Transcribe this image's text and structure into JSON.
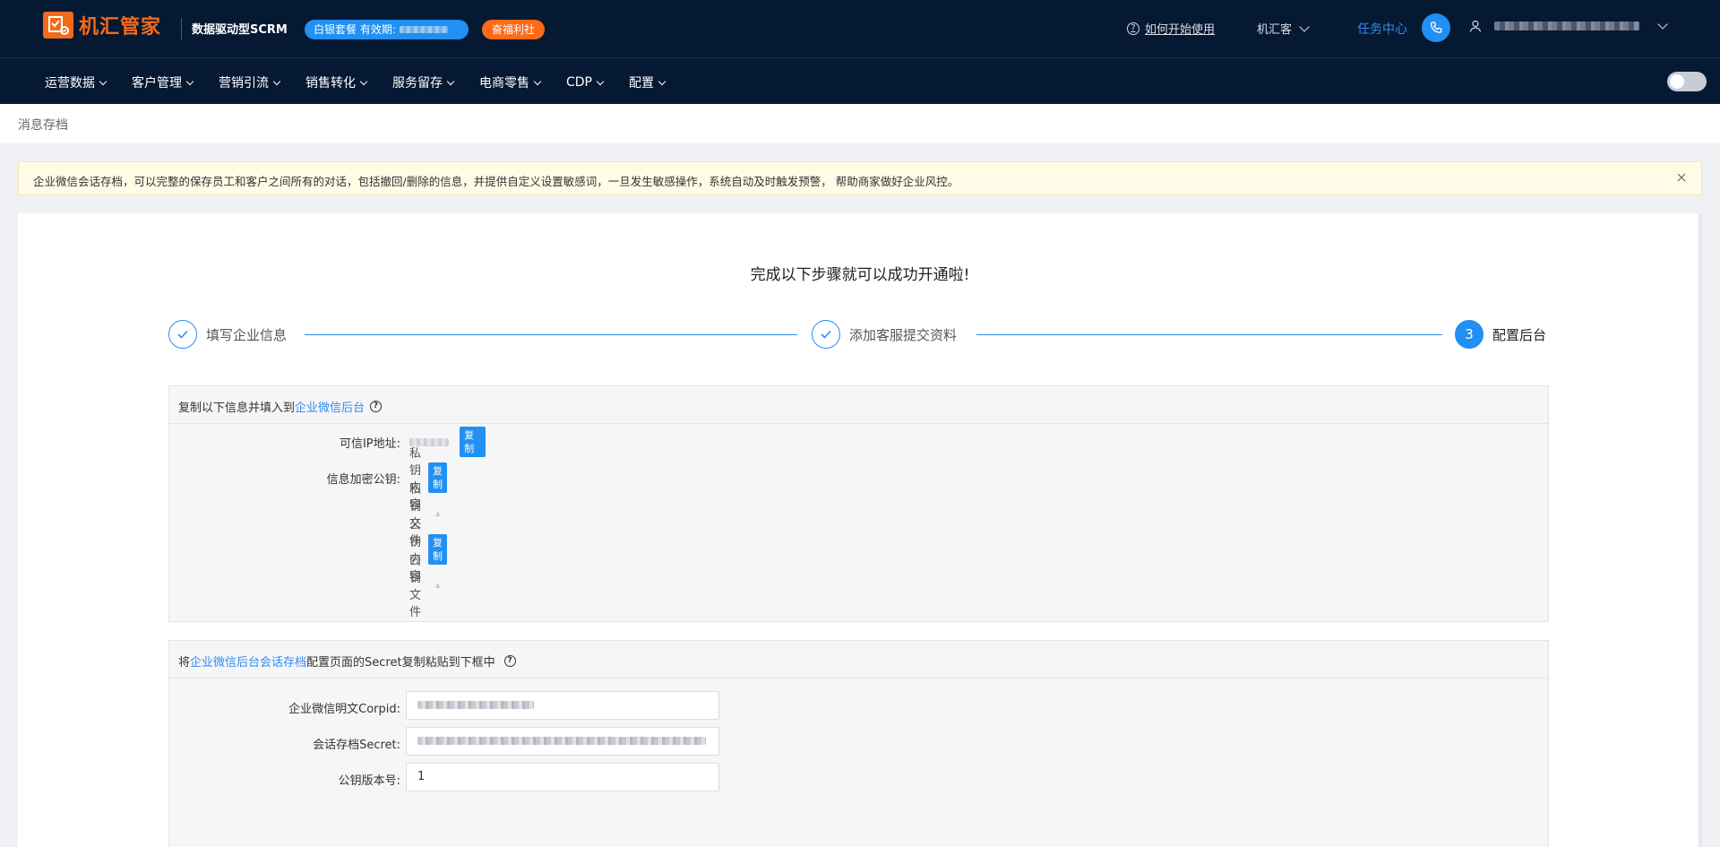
{
  "header": {
    "logo_text": "机汇管家",
    "slogan": "数据驱动型SCRM",
    "package_badge": "白银套餐 有效期:",
    "welfare_badge": "奋福利社",
    "help_link": "如何开始使用",
    "brand_select": "机汇客",
    "task_center": "任务中心"
  },
  "nav": {
    "items": [
      {
        "label": "运营数据"
      },
      {
        "label": "客户管理"
      },
      {
        "label": "营销引流"
      },
      {
        "label": "销售转化"
      },
      {
        "label": "服务留存"
      },
      {
        "label": "电商零售"
      },
      {
        "label": "CDP"
      },
      {
        "label": "配置"
      }
    ]
  },
  "breadcrumb": "消息存档",
  "alert": {
    "text": "企业微信会话存档，可以完整的保存员工和客户之间所有的对话，包括撤回/删除的信息，并提供自定义设置敏感词，一旦发生敏感操作，系统自动及时触发预警， 帮助商家做好企业风控。"
  },
  "main": {
    "title": "完成以下步骤就可以成功开通啦!",
    "steps": [
      {
        "label": "填写企业信息",
        "status": "done"
      },
      {
        "label": "添加客服提交资料",
        "status": "done"
      },
      {
        "number": "3",
        "label": "配置后台",
        "status": "active"
      }
    ],
    "section1": {
      "prefix": "复制以下信息并填入到",
      "link": "企业微信后台",
      "rows": {
        "trusted_ip_label": "可信IP地址:",
        "encrypt_key_label": "信息加密公钥:",
        "private_content": "私钥内容",
        "private_file": "私钥文件",
        "public_content": "公钥内容",
        "public_file": "公钥文件"
      },
      "copy_label": "复制"
    },
    "section2": {
      "prefix": "将",
      "link": "企业微信后台会话存档",
      "suffix": "配置页面的Secret复制粘贴到下框中",
      "fields": {
        "corpid_label": "企业微信明文Corpid:",
        "secret_label": "会话存档Secret:",
        "version_label": "公钥版本号:",
        "version_value": "1"
      }
    }
  },
  "colors": {
    "topbar_bg": "#061933",
    "accent": "#2190f2",
    "brand_orange": "#f26a1b",
    "alert_bg": "#fffbe6"
  }
}
